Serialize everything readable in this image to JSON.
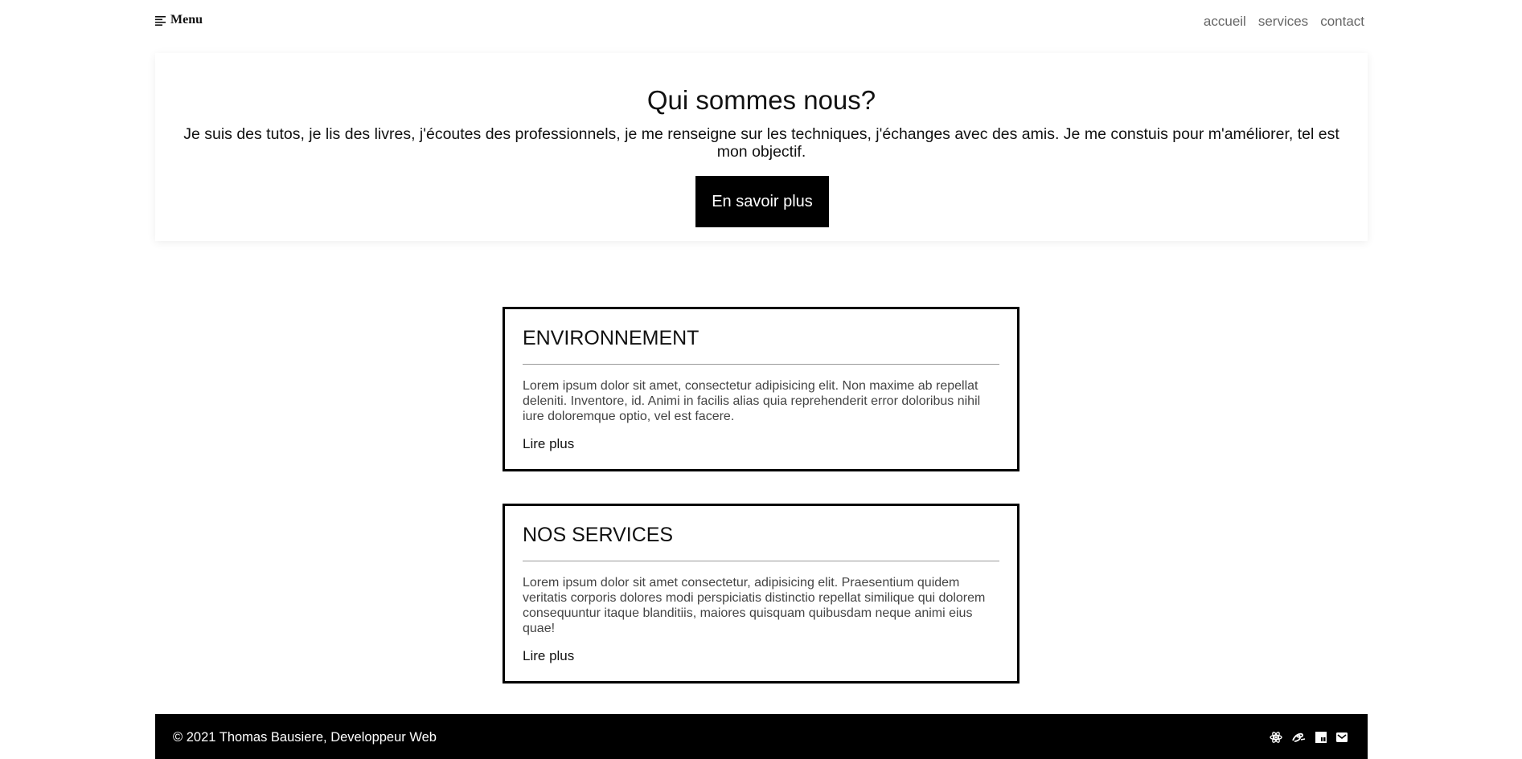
{
  "nav": {
    "menu_label": "Menu",
    "links": [
      "accueil",
      "services",
      "contact"
    ]
  },
  "hero": {
    "title": "Qui sommes nous?",
    "text": "Je suis des tutos, je lis des livres, j'écoutes des professionnels, je me renseigne sur les techniques, j'échanges avec des amis. Je me constuis pour m'améliorer, tel est mon objectif.",
    "button": "En savoir plus"
  },
  "cards": [
    {
      "title": "ENVIRONNEMENT",
      "text": "Lorem ipsum dolor sit amet, consectetur adipisicing elit. Non maxime ab repellat deleniti. Inventore, id. Animi in facilis alias quia reprehenderit error doloribus nihil iure doloremque optio, vel est facere.",
      "link": "Lire plus"
    },
    {
      "title": "NOS SERVICES",
      "text": "Lorem ipsum dolor sit amet consectetur, adipisicing elit. Praesentium quidem veritatis corporis dolores modi perspiciatis distinctio repellat similique qui dolorem consequuntur itaque blanditiis, maiores quisquam quibusdam neque animi eius quae!",
      "link": "Lire plus"
    }
  ],
  "footer": {
    "copyright": "© 2021 Thomas Bausiere, Developpeur Web",
    "icons": [
      "react-icon",
      "sass-icon",
      "js-icon",
      "mail-icon"
    ]
  },
  "colors": {
    "accent": "#000000",
    "background": "#ffffff",
    "nav_link": "#666666"
  }
}
